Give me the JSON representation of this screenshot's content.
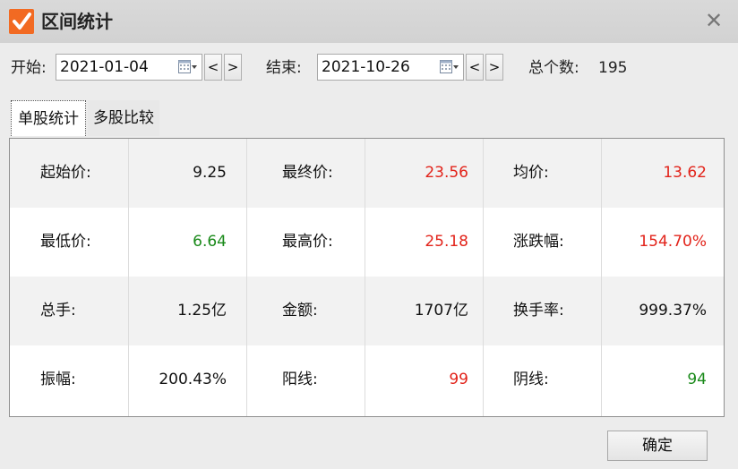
{
  "window": {
    "title": "区间统计",
    "close_symbol": "✕",
    "icon": "checkmark-icon",
    "icon_color": "#f26a22"
  },
  "controls": {
    "start_label": "开始:",
    "start_date": "2021-01-04",
    "end_label": "结束:",
    "end_date": "2021-10-26",
    "prev_label": "<",
    "next_label": ">",
    "count_label": "总个数:",
    "count_value": "195"
  },
  "tabs": [
    {
      "label": "单股统计",
      "active": true
    },
    {
      "label": "多股比较",
      "active": false
    }
  ],
  "colors": {
    "up": "#e2231a",
    "down": "#1a8a1a",
    "normal": "#111111"
  },
  "stats": [
    [
      {
        "label": "起始价:",
        "value": "9.25",
        "color": "normal"
      },
      {
        "label": "最终价:",
        "value": "23.56",
        "color": "up"
      },
      {
        "label": "均价:",
        "value": "13.62",
        "color": "up"
      }
    ],
    [
      {
        "label": "最低价:",
        "value": "6.64",
        "color": "down"
      },
      {
        "label": "最高价:",
        "value": "25.18",
        "color": "up"
      },
      {
        "label": "涨跌幅:",
        "value": "154.70%",
        "color": "up"
      }
    ],
    [
      {
        "label": "总手:",
        "value": "1.25亿",
        "color": "normal"
      },
      {
        "label": "金额:",
        "value": "1707亿",
        "color": "normal"
      },
      {
        "label": "换手率:",
        "value": "999.37%",
        "color": "normal"
      }
    ],
    [
      {
        "label": "振幅:",
        "value": "200.43%",
        "color": "normal"
      },
      {
        "label": "阳线:",
        "value": "99",
        "color": "up"
      },
      {
        "label": "阴线:",
        "value": "94",
        "color": "down"
      }
    ]
  ],
  "ok_label": "确定"
}
